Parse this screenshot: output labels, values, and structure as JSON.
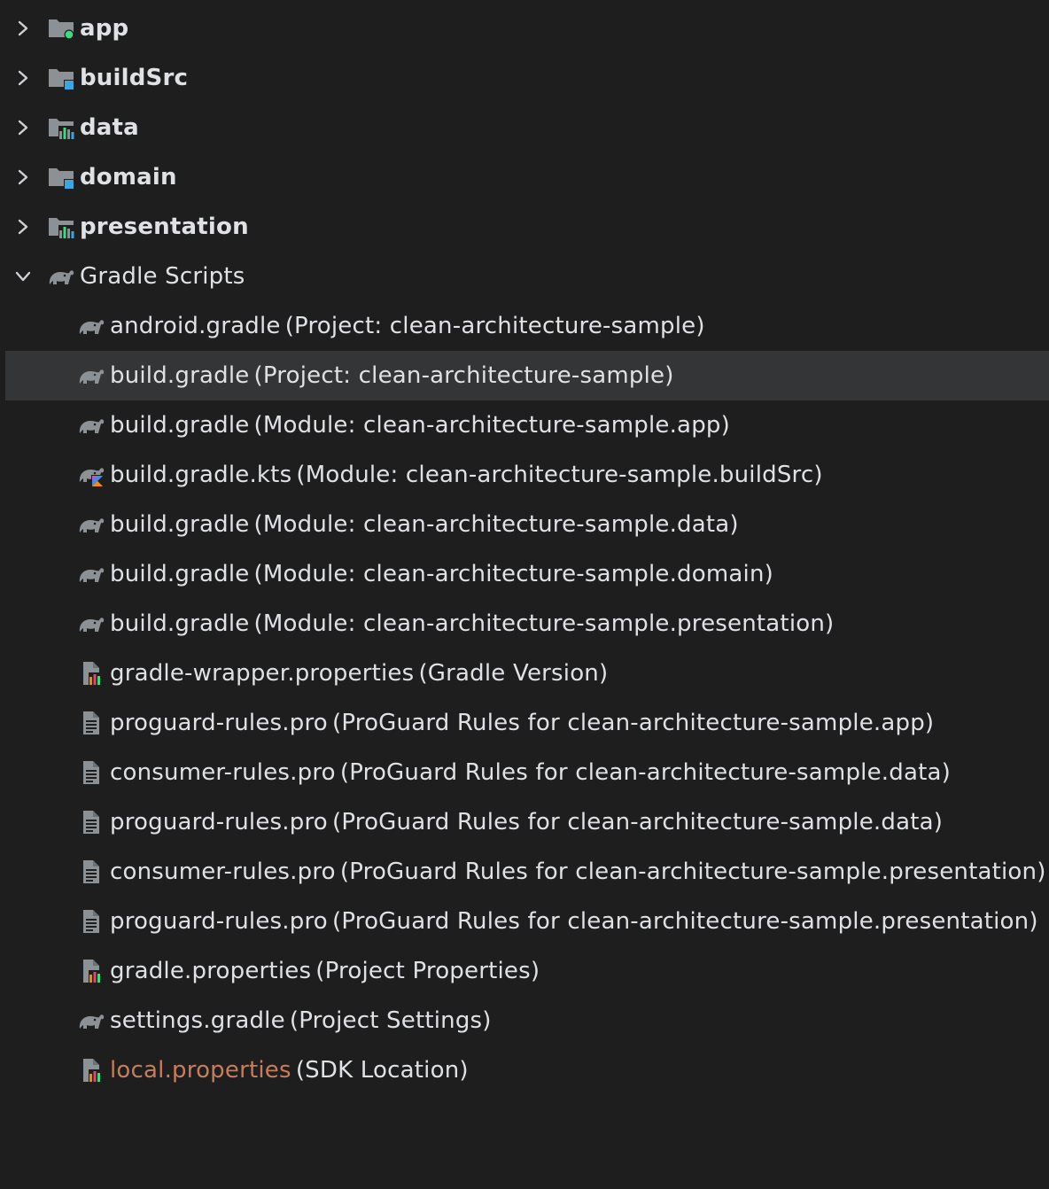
{
  "colors": {
    "background": "#1e1e1f",
    "selection": "#343536",
    "text": "#dfe1e5",
    "ignored_file": "#c77d5b",
    "folder_gray": "#8c9196",
    "module_blue": "#3da5e0",
    "android_green": "#3ddc84"
  },
  "tree": {
    "modules": [
      {
        "name": "app",
        "icon": "android-module-folder-icon"
      },
      {
        "name": "buildSrc",
        "icon": "module-folder-icon"
      },
      {
        "name": "data",
        "icon": "library-module-folder-icon"
      },
      {
        "name": "domain",
        "icon": "module-folder-icon"
      },
      {
        "name": "presentation",
        "icon": "library-module-folder-icon"
      }
    ],
    "gradle_scripts": {
      "label": "Gradle Scripts",
      "icon": "gradle-elephant-icon",
      "files": [
        {
          "name": "android.gradle",
          "hint": "(Project: clean-architecture-sample)",
          "icon": "gradle-file-icon"
        },
        {
          "name": "build.gradle",
          "hint": "(Project: clean-architecture-sample)",
          "icon": "gradle-file-icon",
          "selected": true
        },
        {
          "name": "build.gradle",
          "hint": "(Module: clean-architecture-sample.app)",
          "icon": "gradle-file-icon"
        },
        {
          "name": "build.gradle.kts",
          "hint": "(Module: clean-architecture-sample.buildSrc)",
          "icon": "gradle-kotlin-file-icon"
        },
        {
          "name": "build.gradle",
          "hint": "(Module: clean-architecture-sample.data)",
          "icon": "gradle-file-icon"
        },
        {
          "name": "build.gradle",
          "hint": "(Module: clean-architecture-sample.domain)",
          "icon": "gradle-file-icon"
        },
        {
          "name": "build.gradle",
          "hint": "(Module: clean-architecture-sample.presentation)",
          "icon": "gradle-file-icon"
        },
        {
          "name": "gradle-wrapper.properties",
          "hint": "(Gradle Version)",
          "icon": "properties-file-icon"
        },
        {
          "name": "proguard-rules.pro",
          "hint": "(ProGuard Rules for clean-architecture-sample.app)",
          "icon": "text-file-icon"
        },
        {
          "name": "consumer-rules.pro",
          "hint": "(ProGuard Rules for clean-architecture-sample.data)",
          "icon": "text-file-icon"
        },
        {
          "name": "proguard-rules.pro",
          "hint": "(ProGuard Rules for clean-architecture-sample.data)",
          "icon": "text-file-icon"
        },
        {
          "name": "consumer-rules.pro",
          "hint": "(ProGuard Rules for clean-architecture-sample.presentation)",
          "icon": "text-file-icon"
        },
        {
          "name": "proguard-rules.pro",
          "hint": "(ProGuard Rules for clean-architecture-sample.presentation)",
          "icon": "text-file-icon"
        },
        {
          "name": "gradle.properties",
          "hint": "(Project Properties)",
          "icon": "properties-file-icon"
        },
        {
          "name": "settings.gradle",
          "hint": "(Project Settings)",
          "icon": "gradle-file-icon"
        },
        {
          "name": "local.properties",
          "hint": "(SDK Location)",
          "icon": "properties-file-icon",
          "ignored": true
        }
      ]
    }
  }
}
